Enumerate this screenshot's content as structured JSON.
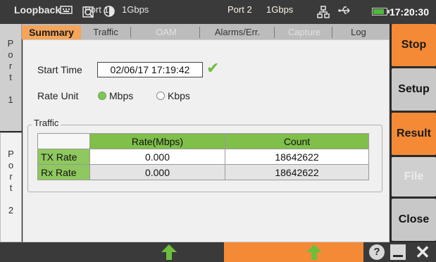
{
  "status_bar": {
    "time": "17:20:30",
    "icons": [
      "keyboard-icon",
      "screenshot-icon",
      "contrast-icon",
      "network-icon",
      "usb-icon",
      "battery-icon"
    ],
    "battery_color": "#4dbb3a"
  },
  "ports": {
    "port1": [
      "P",
      "o",
      "r",
      "t",
      "",
      "1"
    ],
    "port2": [
      "P",
      "o",
      "r",
      "t",
      "",
      "2"
    ]
  },
  "tabs": [
    {
      "label": "Summary",
      "state": "active"
    },
    {
      "label": "Traffic",
      "state": "normal"
    },
    {
      "label": "OAM",
      "state": "disabled"
    },
    {
      "label": "Alarms/Err.",
      "state": "normal"
    },
    {
      "label": "Capture",
      "state": "disabled"
    },
    {
      "label": "Log",
      "state": "normal"
    }
  ],
  "summary": {
    "start_time_label": "Start Time",
    "start_time_value": "02/06/17 17:19:42",
    "rate_unit_label": "Rate Unit",
    "rate_options": [
      {
        "label": "Mbps",
        "selected": true
      },
      {
        "label": "Kbps",
        "selected": false
      }
    ],
    "traffic_group_label": "Traffic",
    "table": {
      "headers": [
        "",
        "Rate(Mbps)",
        "Count"
      ],
      "rows": [
        {
          "label": "TX Rate",
          "rate": "0.000",
          "count": "18642622"
        },
        {
          "label": "Rx Rate",
          "rate": "0.000",
          "count": "18642622"
        }
      ]
    }
  },
  "actions": [
    {
      "label": "Stop",
      "style": "orange"
    },
    {
      "label": "Setup",
      "style": "gray"
    },
    {
      "label": "Result",
      "style": "orange"
    },
    {
      "label": "File",
      "style": "disabled"
    },
    {
      "label": "Close",
      "style": "gray"
    }
  ],
  "bottom_bar": {
    "mode": "Loopback",
    "port1_label": "Port 1",
    "port1_speed": "1Gbps",
    "port2_label": "Port 2",
    "port2_speed": "1Gbps",
    "help_label": "?",
    "accent_color": "#f58a36",
    "link_up_color": "#6cbf3c"
  }
}
